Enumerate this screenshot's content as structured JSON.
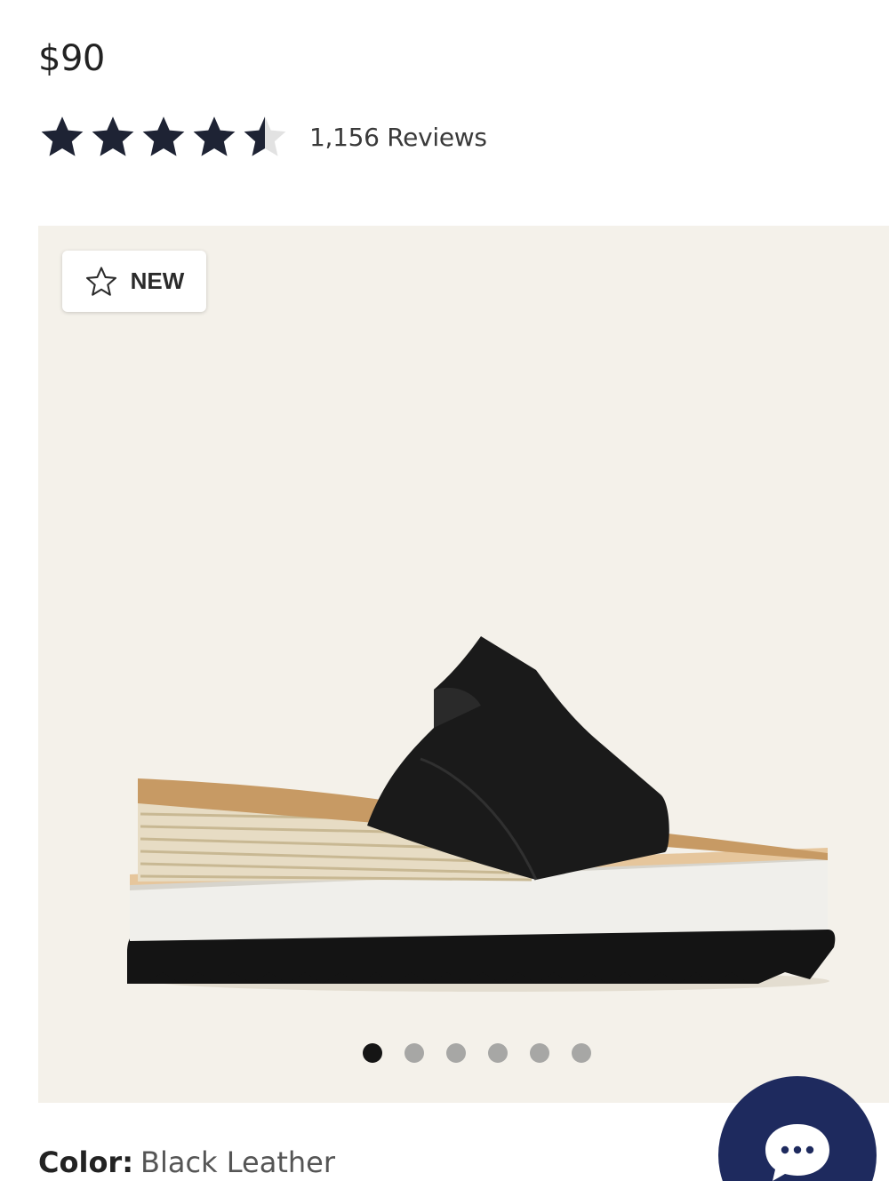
{
  "product": {
    "price": "$90",
    "rating": 4.5,
    "rating_max": 5,
    "reviews_label": "1,156 Reviews",
    "badge_label": "NEW",
    "color_label": "Color:",
    "color_value": "Black Leather"
  },
  "gallery": {
    "image_count": 6,
    "active_index": 0
  },
  "icons": {
    "rating": "star-icon",
    "badge": "star-outline-icon",
    "chat": "chat-bubble-icon"
  },
  "colors": {
    "star": "#1e2334",
    "star_empty": "#e2e2e2",
    "gallery_bg": "#f4f1ea",
    "chat_bg": "#1e2a5e"
  }
}
